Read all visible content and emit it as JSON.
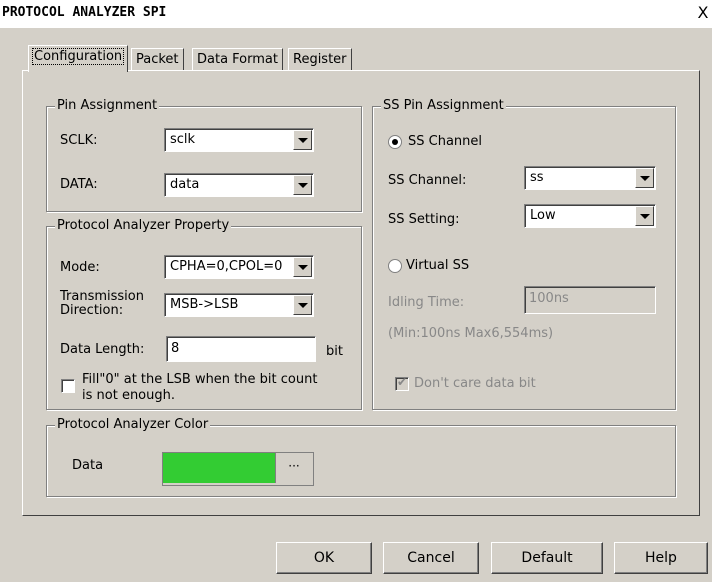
{
  "window": {
    "title": "PROTOCOL ANALYZER SPI",
    "close_glyph": "X"
  },
  "tabs": [
    "Configuration",
    "Packet",
    "Data Format",
    "Register"
  ],
  "pin_assignment": {
    "title": "Pin Assignment",
    "sclk_label": "SCLK:",
    "sclk_value": "sclk",
    "data_label": "DATA:",
    "data_value": "data"
  },
  "property": {
    "title": "Protocol Analyzer Property",
    "mode_label": "Mode:",
    "mode_value": "CPHA=0,CPOL=0",
    "direction_label_1": "Transmission",
    "direction_label_2": "Direction:",
    "direction_value": "MSB->LSB",
    "length_label": "Data Length:",
    "length_value": "8",
    "length_unit": "bit",
    "fill_label_1": "Fill\"0\" at the LSB when the bit count",
    "fill_label_2": "is not enough.",
    "fill_checked": false
  },
  "ss": {
    "title": "SS Pin Assignment",
    "ss_channel_radio": "SS Channel",
    "channel_label": "SS Channel:",
    "channel_value": "ss",
    "setting_label": "SS Setting:",
    "setting_value": "Low",
    "virtual_radio": "Virtual SS",
    "idle_label": "Idling Time:",
    "idle_value": "100ns",
    "range": "(Min:100ns  Max6,554ms)",
    "dont_care": "Don't care data bit",
    "dont_care_checked": true
  },
  "color": {
    "title": "Protocol Analyzer Color",
    "data_label": "Data",
    "data_color": "#33cc33",
    "more": "···"
  },
  "buttons": {
    "ok": "OK",
    "cancel": "Cancel",
    "default": "Default",
    "help": "Help"
  }
}
